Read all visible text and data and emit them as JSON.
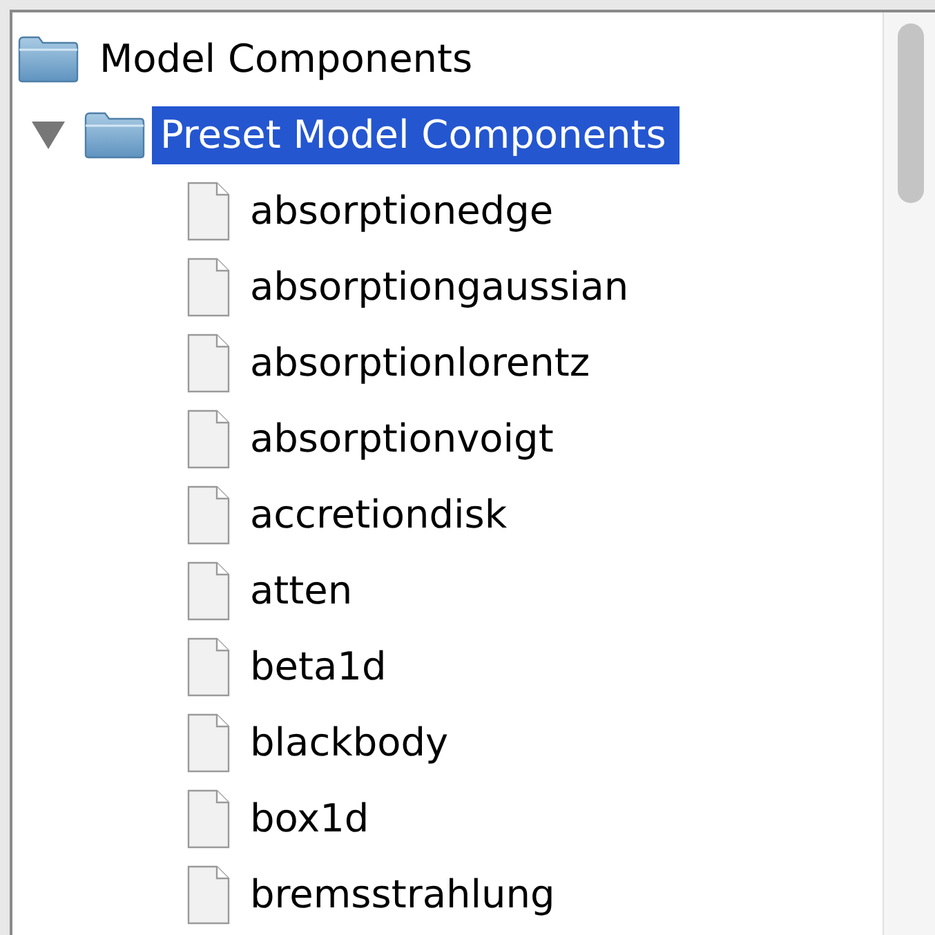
{
  "tree": [
    {
      "label": "Model Components",
      "kind": "folder",
      "selected": false,
      "children": [
        {
          "label": "Preset Model Components",
          "kind": "folder",
          "selected": true,
          "expanded": true,
          "children": [
            {
              "label": "absorptionedge",
              "kind": "file",
              "selected": false
            },
            {
              "label": "absorptiongaussian",
              "kind": "file",
              "selected": false
            },
            {
              "label": "absorptionlorentz",
              "kind": "file",
              "selected": false
            },
            {
              "label": "absorptionvoigt",
              "kind": "file",
              "selected": false
            },
            {
              "label": "accretiondisk",
              "kind": "file",
              "selected": false
            },
            {
              "label": "atten",
              "kind": "file",
              "selected": false
            },
            {
              "label": "beta1d",
              "kind": "file",
              "selected": false
            },
            {
              "label": "blackbody",
              "kind": "file",
              "selected": false
            },
            {
              "label": "box1d",
              "kind": "file",
              "selected": false
            },
            {
              "label": "bremsstrahlung",
              "kind": "file",
              "selected": false
            }
          ]
        }
      ]
    }
  ]
}
